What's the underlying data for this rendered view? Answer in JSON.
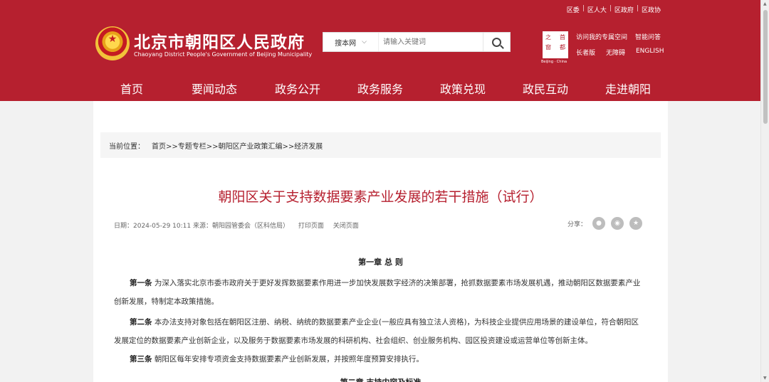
{
  "colors": {
    "brand_red": "#b6202f",
    "page_bg": "#f2f2f2"
  },
  "top_links": [
    "区委",
    "区人大",
    "区政府",
    "区政协"
  ],
  "site": {
    "title": "北京市朝阳区人民政府",
    "subtitle": "Chaoyang District People's Government of Beijing Municipality",
    "emblem_icon": "national-emblem-icon"
  },
  "search": {
    "scope": "搜本网",
    "placeholder": "请输入关键词",
    "icon": "search-icon"
  },
  "capital_logo": {
    "chars": [
      "之",
      "首",
      "窗",
      "都"
    ],
    "en": "Beijing · China"
  },
  "quick_links": {
    "row1": [
      "访问我的专属空间",
      "智能问答"
    ],
    "row2": [
      "长者版",
      "无障碍",
      "ENGLISH"
    ]
  },
  "nav": [
    "首页",
    "要闻动态",
    "政务公开",
    "政务服务",
    "政策兑现",
    "政民互动",
    "走进朝阳"
  ],
  "breadcrumb": {
    "label": "当前位置：",
    "path": "首页>>专题专栏>>朝阳区产业政策汇编>>经济发展"
  },
  "article": {
    "title": "朝阳区关于支持数据要素产业发展的若干措施（试行）",
    "date": "日期：2024-05-29 10:11",
    "source": "来源：朝阳园管委会（区科信局）",
    "print": "打印页面",
    "close": "关闭页面",
    "share_label": "分享：",
    "chapter1": "第一章 总 则",
    "p1_lead": "第一条",
    "p1_text": "为深入落实北京市委市政府关于更好发挥数据要素作用进一步加快发展数字经济的决策部署，抢抓数据要素市场发展机遇，推动朝阳区数据要素产业创新发展，特制定本政策措施。",
    "p2_lead": "第二条",
    "p2_text": "本办法支持对象包括在朝阳区注册、纳税、纳统的数据要素产业企业(一般应具有独立法人资格)，为科技企业提供应用场景的建设单位，符合朝阳区发展定位的数据要素产业创新企业，以及服务于数据要素市场发展的科研机构、社会组织、创业服务机构、园区投资建设或运营单位等创新主体。",
    "p3_lead": "第三条",
    "p3_text": "朝阳区每年安排专项资金支持数据要素产业创新发展，并按照年度预算安排执行。",
    "chapter2": "第二章 支持内容及标准"
  }
}
